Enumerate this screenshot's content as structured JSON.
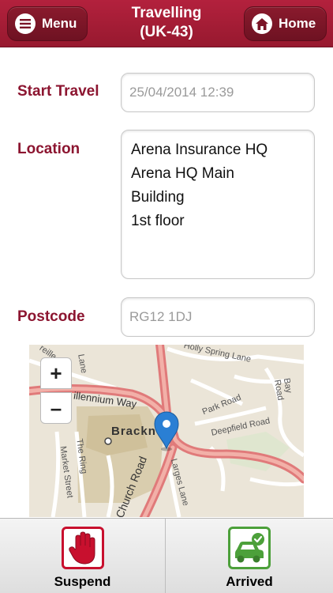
{
  "header": {
    "menu_label": "Menu",
    "title_line1": "Travelling",
    "title_line2": "(UK-43)",
    "home_label": "Home"
  },
  "form": {
    "start_travel_label": "Start Travel",
    "start_travel_value": "25/04/2014 12:39",
    "location_label": "Location",
    "location_lines": [
      "Arena Insurance HQ",
      "Arena HQ Main",
      "Building",
      "1st floor"
    ],
    "postcode_label": "Postcode",
    "postcode_value": "RG12 1DJ"
  },
  "map": {
    "zoom_in": "+",
    "zoom_out": "–",
    "labels": {
      "holly_spring": "Holly Spring Lane",
      "millennium": "illennium Way",
      "park_road": "Park Road",
      "deepfield": "Deepfield Road",
      "bay_road": "Bay Road",
      "the_ring": "The Ring",
      "market_street": "Market Street",
      "church_road": "Church Road",
      "larges_lane": "Larges Lane",
      "brack": "Brackn",
      "lane": "Lane",
      "reille": "reille"
    }
  },
  "footer": {
    "suspend_label": "Suspend",
    "arrived_label": "Arrived"
  },
  "colors": {
    "brand": "#a51d37",
    "label": "#8c1530",
    "suspend": "#c8102e",
    "arrived": "#4ca03a"
  },
  "icons": {
    "menu": "hamburger-icon",
    "home": "home-icon",
    "map_pin": "map-pin-icon",
    "suspend": "hand-stop-icon",
    "arrived": "car-check-icon"
  }
}
